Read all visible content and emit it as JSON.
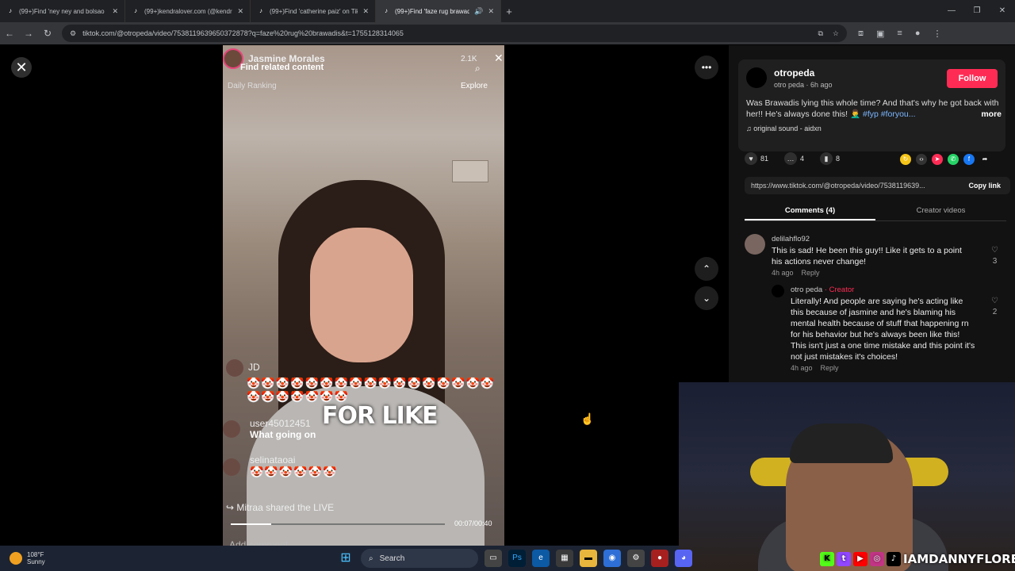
{
  "browser": {
    "tabs": [
      {
        "title": "(99+)Find 'ney ney and bolsao",
        "active": false
      },
      {
        "title": "(99+)kendralover.com (@kendr",
        "active": false
      },
      {
        "title": "(99+)Find 'catherine paiz' on Tik",
        "active": false
      },
      {
        "title": "(99+)Find 'faze rug brawad",
        "active": true
      }
    ],
    "url": "tiktok.com/@otropeda/video/7538119639650372878?q=faze%20rug%20brawadis&t=1755128314065"
  },
  "video": {
    "host_name": "Jasmine Morales",
    "find_related": "Find related content",
    "viewers": "2.1K",
    "daily_ranking": "Daily Ranking",
    "explore": "Explore",
    "chat": [
      {
        "user": "JD",
        "message": "🤡🤡🤡🤡🤡🤡🤡🤡🤡🤡🤡🤡🤡🤡🤡🤡🤡🤡🤡🤡🤡🤡🤡🤡"
      },
      {
        "user": "user45012451",
        "message": "What going on"
      },
      {
        "user": "selinataoai",
        "message": "🤡🤡🤡🤡🤡🤡"
      }
    ],
    "shared": "Mitraa shared the LIVE",
    "caption": "FOR LIKE",
    "time": "00:07/00:40",
    "progress": 0.19,
    "add_comment": "Add comment..."
  },
  "post": {
    "username": "otropeda",
    "subline": "otro peda · 6h ago",
    "follow": "Follow",
    "description": "Was Brawadis lying this whole time? And that's why he got back with her!! He's always done this! 🤦‍♂️",
    "tags": "#fyp #foryou...",
    "more": "more",
    "sound": "♫  original sound - aidxn",
    "likes": "81",
    "comments_count": "4",
    "saves": "8",
    "link": "https://www.tiktok.com/@otropeda/video/7538119639...",
    "copy_link": "Copy link",
    "tab_comments": "Comments (4)",
    "tab_creator": "Creator videos"
  },
  "comments": [
    {
      "name": "delilahflo92",
      "text": "This is sad! He been this guy!! Like it gets to a point his actions never change!",
      "time": "4h ago",
      "reply": "Reply",
      "likes": "3"
    },
    {
      "name": "otro peda",
      "badge": "· Creator",
      "text": "Literally! And people are saying he's acting like this because of jasmine and he's blaming his mental health because of stuff that happening rn for his behavior but he's always been like this! This isn't just a one time mistake and this point it's not just mistakes it's choices!",
      "time": "4h ago",
      "reply": "Reply",
      "likes": "2"
    }
  ],
  "overlay": {
    "handle": "IAMDANNYFLORES"
  },
  "taskbar": {
    "temp": "108°F",
    "condition": "Sunny",
    "search": "Search"
  }
}
